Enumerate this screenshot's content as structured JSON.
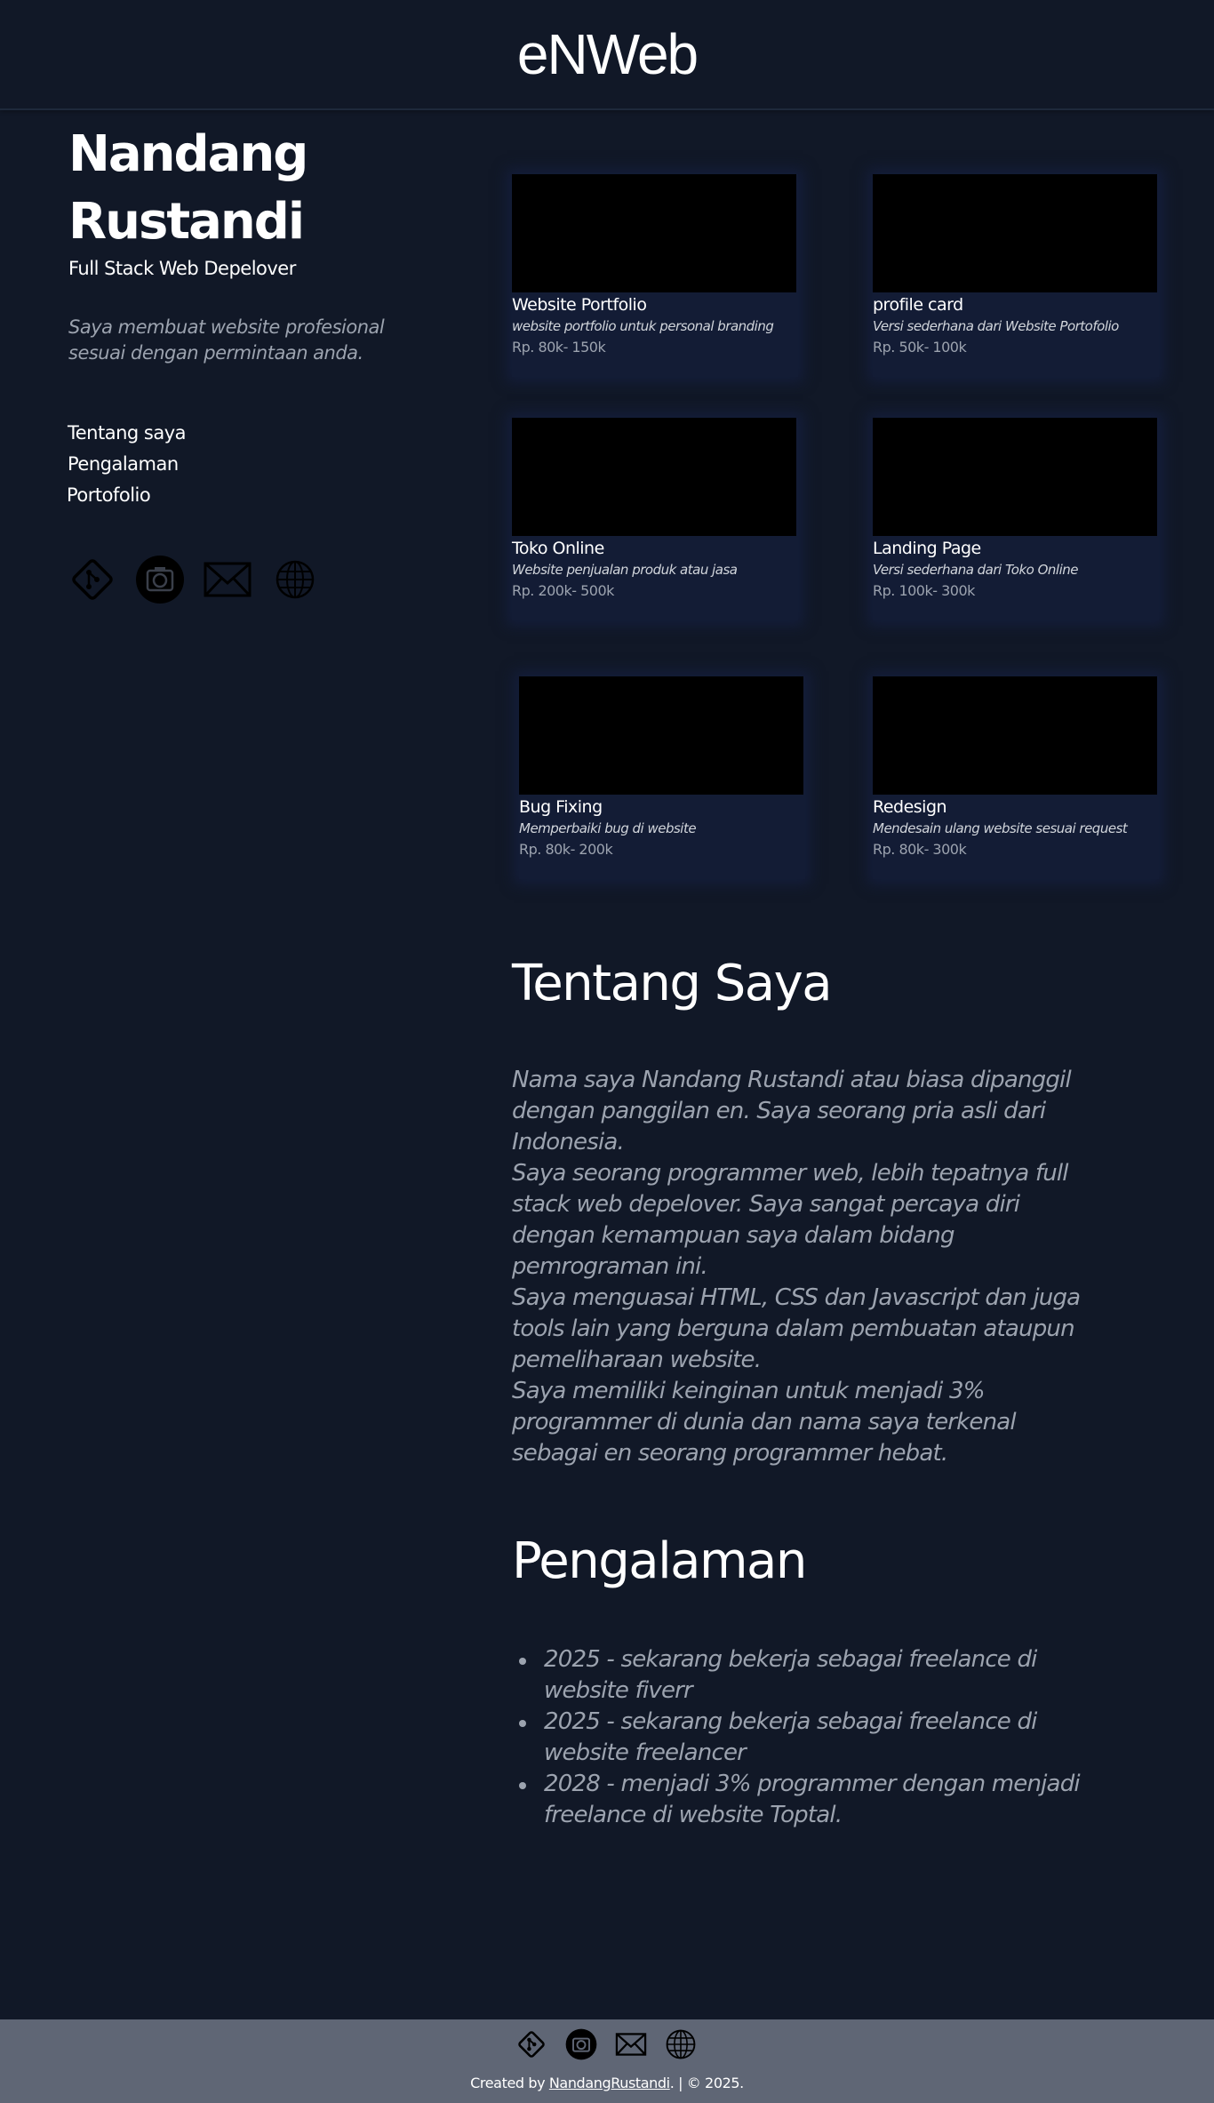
{
  "header": {
    "brand": "eNWeb"
  },
  "profile": {
    "name": "Nandang Rustandi",
    "role": "Full Stack Web Depelover",
    "tagline": "Saya membuat website profesional sesuai dengan permintaan anda."
  },
  "nav": {
    "items": [
      {
        "label": "Tentang saya"
      },
      {
        "label": "Pengalaman"
      },
      {
        "label": "Portofolio"
      }
    ]
  },
  "socials": {
    "icons": [
      "git-icon",
      "camera-icon",
      "mail-icon",
      "globe-icon"
    ]
  },
  "portfolio": {
    "cards": [
      {
        "title": "Website Portfolio",
        "desc": "website portfolio untuk personal branding",
        "price": "Rp. 80k- 150k"
      },
      {
        "title": "profile card",
        "desc": "Versi sederhana dari Website Portofolio",
        "price": "Rp. 50k- 100k"
      },
      {
        "title": " Toko Online",
        "desc": "Website penjualan produk atau jasa",
        "price": "Rp. 200k- 500k"
      },
      {
        "title": " Landing Page",
        "desc": "Versi sederhana dari Toko Online",
        "price": "Rp. 100k- 300k"
      },
      {
        "title": " Bug Fixing",
        "desc": "Memperbaiki bug di website",
        "price": "Rp. 80k- 200k"
      },
      {
        "title": "Redesign",
        "desc": "Mendesain ulang website sesuai request",
        "price": "Rp. 80k- 300k"
      }
    ]
  },
  "about": {
    "title": "Tentang Saya",
    "paragraphs": [
      "Nama saya Nandang Rustandi atau biasa dipanggil dengan panggilan en. Saya seorang pria asli dari Indonesia.",
      "Saya seorang programmer web, lebih tepatnya full stack web depelover. Saya sangat percaya diri dengan kemampuan saya dalam bidang pemrograman ini.",
      "Saya menguasai HTML, CSS dan Javascript dan juga tools lain yang berguna dalam pembuatan ataupun pemeliharaan website.",
      "Saya memiliki keinginan untuk menjadi 3% programmer di dunia dan nama saya terkenal sebagai en seorang programmer hebat."
    ]
  },
  "experience": {
    "title": "Pengalaman",
    "items": [
      "2025 - sekarang bekerja sebagai freelance di website fiverr",
      "2025 - sekarang bekerja sebagai freelance di website freelancer",
      "2028 - menjadi 3% programmer dengan menjadi freelance di website Toptal."
    ]
  },
  "footer": {
    "credit_prefix": "Created by ",
    "credit_link": "NandangRustandi",
    "credit_suffix": ". | © 2025."
  },
  "colors": {
    "background": "#111827",
    "card": "#131c35",
    "muted_text": "#9ca3af",
    "footer": "#5f6675"
  }
}
